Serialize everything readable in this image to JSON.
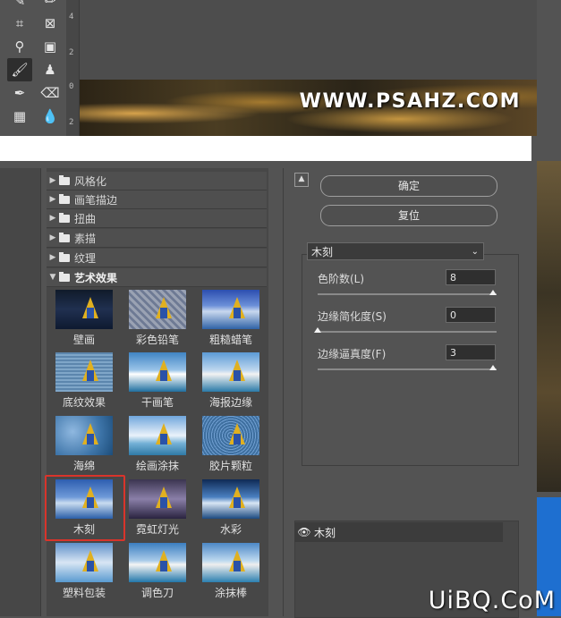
{
  "canvas": {
    "watermark": "WWW.PSAHZ.COM",
    "ruler_marks": [
      "4",
      "2",
      "0",
      "2"
    ]
  },
  "toolbar": {
    "icons": [
      "brush-icon",
      "pencil-icon",
      "crop-icon",
      "frame-icon",
      "eyedropper-icon",
      "patch-icon",
      "paintbrush-icon",
      "stamp-icon",
      "history-brush-icon",
      "eraser-icon",
      "gradient-icon",
      "blur-icon"
    ]
  },
  "gallery": {
    "categories": [
      {
        "label": "风格化",
        "open": false
      },
      {
        "label": "画笔描边",
        "open": false
      },
      {
        "label": "扭曲",
        "open": false
      },
      {
        "label": "素描",
        "open": false
      },
      {
        "label": "纹理",
        "open": false
      },
      {
        "label": "艺术效果",
        "open": true
      }
    ],
    "filters": [
      [
        "壁画",
        "彩色铅笔",
        "粗糙蜡笔"
      ],
      [
        "底纹效果",
        "干画笔",
        "海报边缘"
      ],
      [
        "海绵",
        "绘画涂抹",
        "胶片颗粒"
      ],
      [
        "木刻",
        "霓虹灯光",
        "水彩"
      ],
      [
        "塑料包装",
        "调色刀",
        "涂抹棒"
      ]
    ],
    "selected": "木刻"
  },
  "buttons": {
    "ok": "确定",
    "reset": "复位",
    "collapse_icon": "collapse-up-icon"
  },
  "settings": {
    "filter_name": "木刻",
    "params": [
      {
        "label": "色阶数(L)",
        "value": "8",
        "fraction": 1.0
      },
      {
        "label": "边缘简化度(S)",
        "value": "0",
        "fraction": 0.0
      },
      {
        "label": "边缘逼真度(F)",
        "value": "3",
        "fraction": 1.0
      }
    ]
  },
  "layers": {
    "effect_name": "木刻"
  },
  "site_watermark": "UiBQ.CoM"
}
